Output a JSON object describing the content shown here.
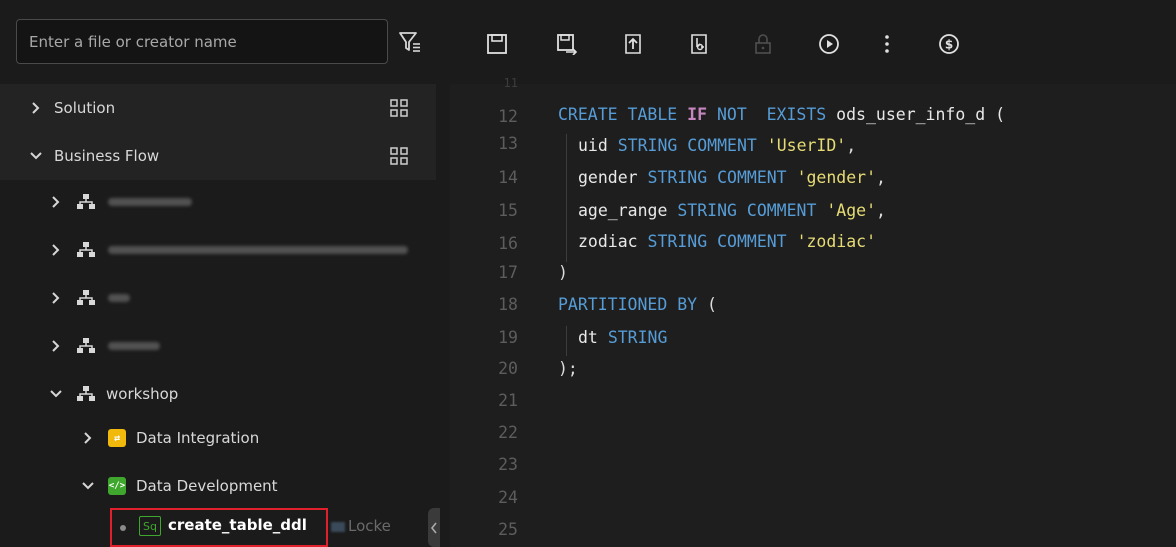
{
  "sidebar": {
    "search": {
      "placeholder": "Enter a file or creator name"
    },
    "sections": [
      {
        "label": "Solution"
      },
      {
        "label": "Business Flow"
      }
    ],
    "workshop_label": "workshop",
    "children": [
      {
        "label": "Data Integration"
      },
      {
        "label": "Data Development"
      }
    ],
    "selected_file": {
      "badge": "Sq",
      "name": "create_table_ddl",
      "lock_text": "Locke"
    }
  },
  "editor": {
    "lines": [
      {
        "num": "11"
      },
      {
        "num": "12"
      },
      {
        "num": "13"
      },
      {
        "num": "14"
      },
      {
        "num": "15"
      },
      {
        "num": "16"
      },
      {
        "num": "17"
      },
      {
        "num": "18"
      },
      {
        "num": "19"
      },
      {
        "num": "20"
      },
      {
        "num": "21"
      },
      {
        "num": "22"
      },
      {
        "num": "23"
      },
      {
        "num": "24"
      },
      {
        "num": "25"
      }
    ],
    "tokens": {
      "create_table": "CREATE TABLE ",
      "if": "IF",
      "not_exists": " NOT  EXISTS ",
      "table_name": "ods_user_info_d (",
      "uid": "uid ",
      "gender": "gender ",
      "age_range": "age_range ",
      "zodiac": "zodiac ",
      "string_comment": "STRING COMMENT ",
      "c_uid": "'UserID'",
      "c_gender": "'gender'",
      "c_age": "'Age'",
      "c_zodiac": "'zodiac'",
      "comma": ",",
      "close_paren": ")",
      "partitioned_by": "PARTITIONED BY ",
      "open_paren": "(",
      "dt": "dt ",
      "string": "STRING",
      "end": ");"
    }
  },
  "colors": {
    "keyword": "#569cd6",
    "keyword_if": "#c586c0",
    "string": "#e6db74",
    "selection_border": "#e0202b"
  }
}
